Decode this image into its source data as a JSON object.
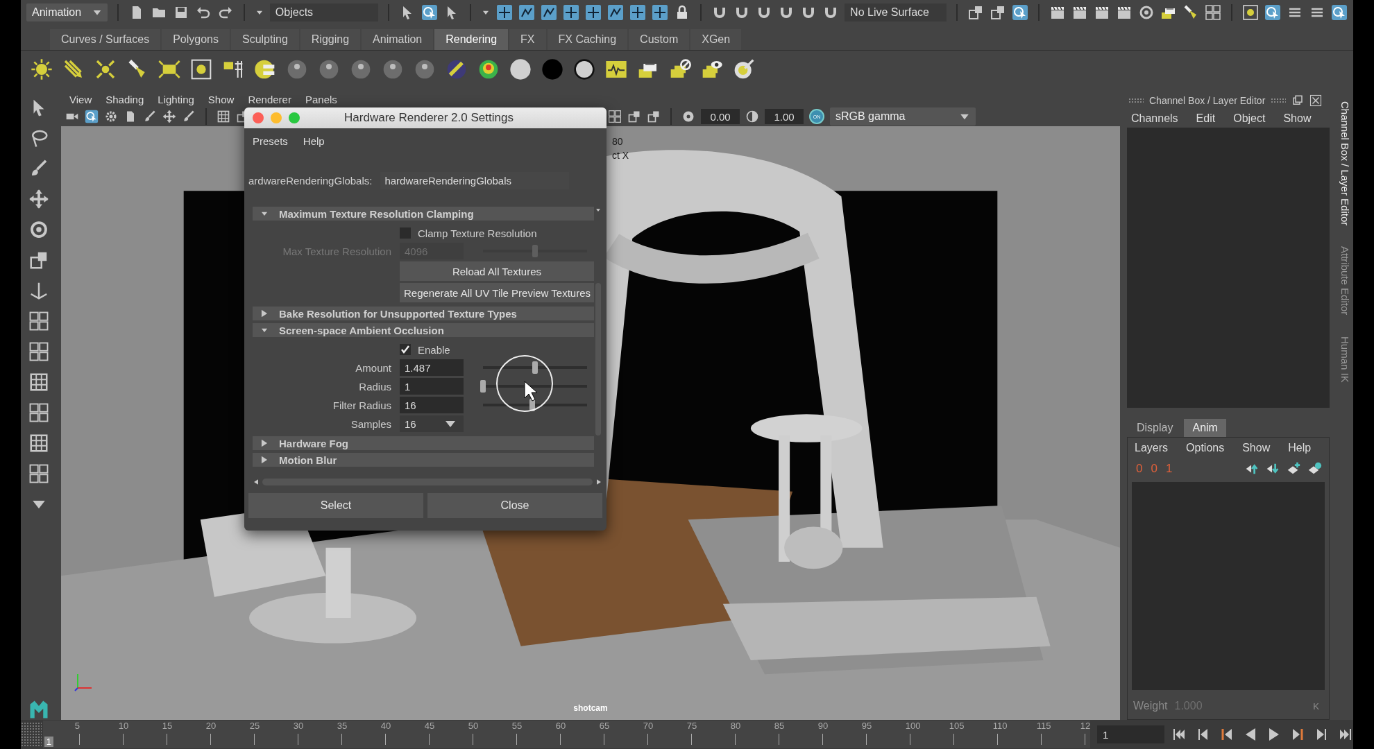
{
  "status_line": {
    "mode_menu": "Animation",
    "selection_mode": "Objects",
    "live_surface": "No Live Surface"
  },
  "shelf": {
    "tabs": [
      {
        "label": "Curves / Surfaces",
        "selected": false
      },
      {
        "label": "Polygons",
        "selected": false
      },
      {
        "label": "Sculpting",
        "selected": false
      },
      {
        "label": "Rigging",
        "selected": false
      },
      {
        "label": "Animation",
        "selected": false
      },
      {
        "label": "Rendering",
        "selected": true
      },
      {
        "label": "FX",
        "selected": false
      },
      {
        "label": "FX Caching",
        "selected": false
      },
      {
        "label": "Custom",
        "selected": false
      },
      {
        "label": "XGen",
        "selected": false
      }
    ]
  },
  "viewport": {
    "menus": [
      "View",
      "Shading",
      "Lighting",
      "Show",
      "Renderer",
      "Panels"
    ],
    "exposure": "0.00",
    "gamma": "1.00",
    "color_management": {
      "label": "ON",
      "on": true
    },
    "color_space": "sRGB gamma",
    "hud_texts": [
      "80",
      "ct X"
    ],
    "camera": "shotcam"
  },
  "dialog": {
    "title": "Hardware Renderer 2.0 Settings",
    "menus": [
      "Presets",
      "Help"
    ],
    "node_label": "ardwareRenderingGlobals:",
    "node_value": "hardwareRenderingGlobals",
    "sections": [
      {
        "title": "Maximum Texture Resolution Clamping",
        "expanded": true,
        "rows": [
          {
            "kind": "checkbox",
            "label": "Clamp Texture Resolution",
            "checked": false
          },
          {
            "kind": "slider",
            "label": "Max Texture Resolution",
            "value": "4096",
            "level": 0.5,
            "disabled": true
          },
          {
            "kind": "button",
            "label": "Reload All Textures"
          },
          {
            "kind": "button",
            "label": "Regenerate All UV Tile Preview Textures"
          }
        ]
      },
      {
        "title": "Bake Resolution for Unsupported Texture Types",
        "expanded": false
      },
      {
        "title": "Screen-space Ambient Occlusion",
        "expanded": true,
        "rows": [
          {
            "kind": "checkbox",
            "label": "Enable",
            "checked": true
          },
          {
            "kind": "slider",
            "label": "Amount",
            "value": "1.487",
            "level": 0.5,
            "disabled": false
          },
          {
            "kind": "slider",
            "label": "Radius",
            "value": "1",
            "level": 0.0,
            "disabled": false
          },
          {
            "kind": "slider",
            "label": "Filter Radius",
            "value": "16",
            "level": 0.47,
            "disabled": false
          },
          {
            "kind": "dropdown",
            "label": "Samples",
            "value": "16"
          }
        ]
      },
      {
        "title": "Hardware Fog",
        "expanded": false
      },
      {
        "title": "Motion Blur",
        "expanded": false
      }
    ],
    "buttons": [
      "Select",
      "Close"
    ]
  },
  "right_panel": {
    "title": "Channel Box / Layer Editor",
    "menus": [
      "Channels",
      "Edit",
      "Object",
      "Show"
    ],
    "layer_tabs": [
      {
        "label": "Display",
        "selected": false
      },
      {
        "label": "Anim",
        "selected": true
      }
    ],
    "layer_menus": [
      "Layers",
      "Options",
      "Show",
      "Help"
    ],
    "layer_buttons": [
      "0",
      "0",
      "1"
    ],
    "weight_label": "Weight",
    "weight_value": "1.000",
    "key_button": "K"
  },
  "side_tabs": [
    {
      "label": "Channel Box / Layer Editor",
      "selected": true
    },
    {
      "label": "Attribute Editor",
      "selected": false
    },
    {
      "label": "Human IK",
      "selected": false
    }
  ],
  "timeline": {
    "current_frame": "1",
    "ticks": [
      "5",
      "10",
      "15",
      "20",
      "25",
      "30",
      "35",
      "40",
      "45",
      "50",
      "55",
      "60",
      "65",
      "70",
      "75",
      "80",
      "85",
      "90",
      "95",
      "100",
      "105",
      "110",
      "115",
      "12"
    ],
    "frame_field": "1"
  }
}
